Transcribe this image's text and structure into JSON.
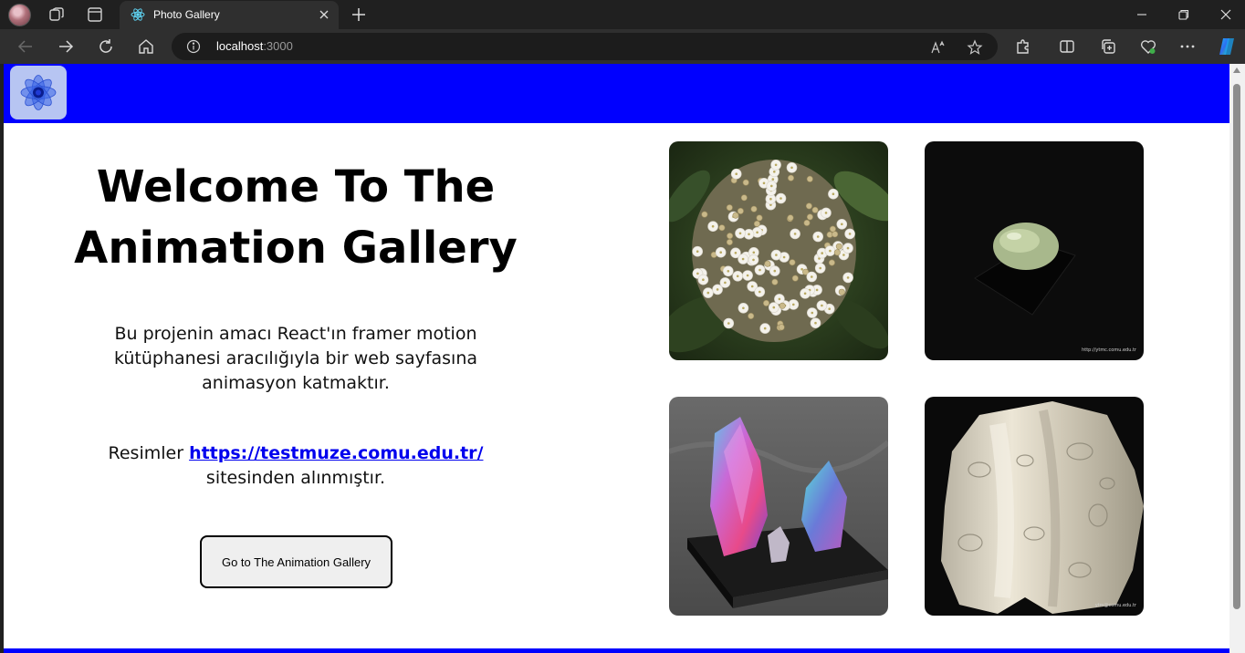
{
  "browser": {
    "tab_title": "Photo Gallery",
    "url_host": "localhost",
    "url_port": ":3000",
    "icons": [
      "profile-avatar",
      "workspaces-icon",
      "tab-actions-icon",
      "react-favicon",
      "close-icon",
      "plus-icon",
      "minimize-icon",
      "restore-icon",
      "window-close-icon",
      "back-icon",
      "forward-icon",
      "reload-icon",
      "home-icon",
      "info-icon",
      "read-aloud-icon",
      "favorite-star-icon",
      "extensions-icon",
      "split-screen-icon",
      "collections-icon",
      "browser-essentials-icon",
      "more-icon",
      "copilot-icon"
    ]
  },
  "header": {
    "bg_color": "#0000ff",
    "logo_icon": "flower-logo-icon"
  },
  "hero": {
    "title": "Welcome To The Animation Gallery",
    "description": "Bu projenin amacı React'ın framer motion kütüphanesi aracılığıyla bir web sayfasına animasyon katmaktır.",
    "credit_prefix": "Resimler",
    "credit_link": "https://testmuze.comu.edu.tr/",
    "credit_suffix": "sitesinden alınmıştır.",
    "button_label": "Go to The Animation Gallery"
  },
  "gallery": {
    "photos": [
      {
        "subject": "white flower cluster",
        "caption": ""
      },
      {
        "subject": "green gemstone on black",
        "caption": "http://ytmc.comu.edu.tr"
      },
      {
        "subject": "iridescent mineral crystals",
        "caption": ""
      },
      {
        "subject": "white stone on black",
        "caption": "ytm@comu.edu.tr"
      }
    ]
  }
}
